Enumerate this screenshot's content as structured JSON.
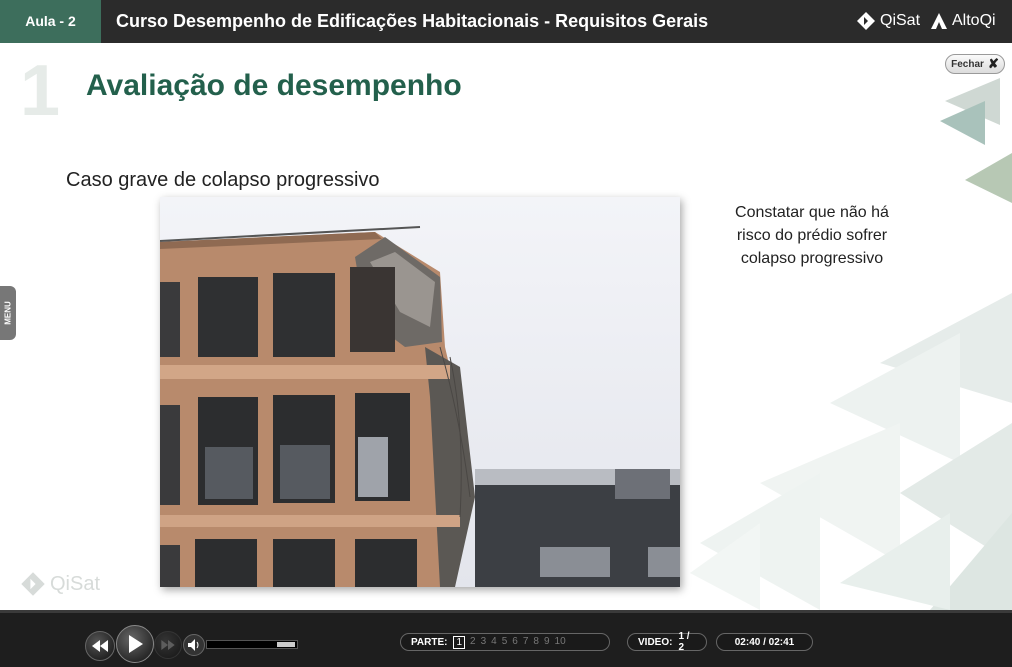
{
  "header": {
    "lesson_label": "Aula - 2",
    "course_title": "Curso Desempenho de Edificações Habitacionais - Requisitos Gerais",
    "logo_qisat": "QiSat",
    "logo_altoqi": "AltoQi"
  },
  "slide": {
    "number": "1",
    "heading": "Avaliação de desempenho",
    "subtitle": "Caso grave de colapso progressivo",
    "side_text": "Constatar que não há risco do prédio sofrer colapso progressivo",
    "close_label": "Fechar",
    "menu_label": "MENU",
    "watermark": "QiSat"
  },
  "player": {
    "parts_label": "PARTE:",
    "parts": [
      "1",
      "2",
      "3",
      "4",
      "5",
      "6",
      "7",
      "8",
      "9",
      "10"
    ],
    "current_part": "1",
    "video_label": "VIDEO:",
    "video_value": "1 / 2",
    "time": "02:40 / 02:41",
    "volume_level": 1.0
  },
  "colors": {
    "topbar": "#2b2b2b",
    "lesson_tab": "#3d6e5c",
    "heading": "#23604c",
    "player_bar": "#1e1e1e"
  }
}
